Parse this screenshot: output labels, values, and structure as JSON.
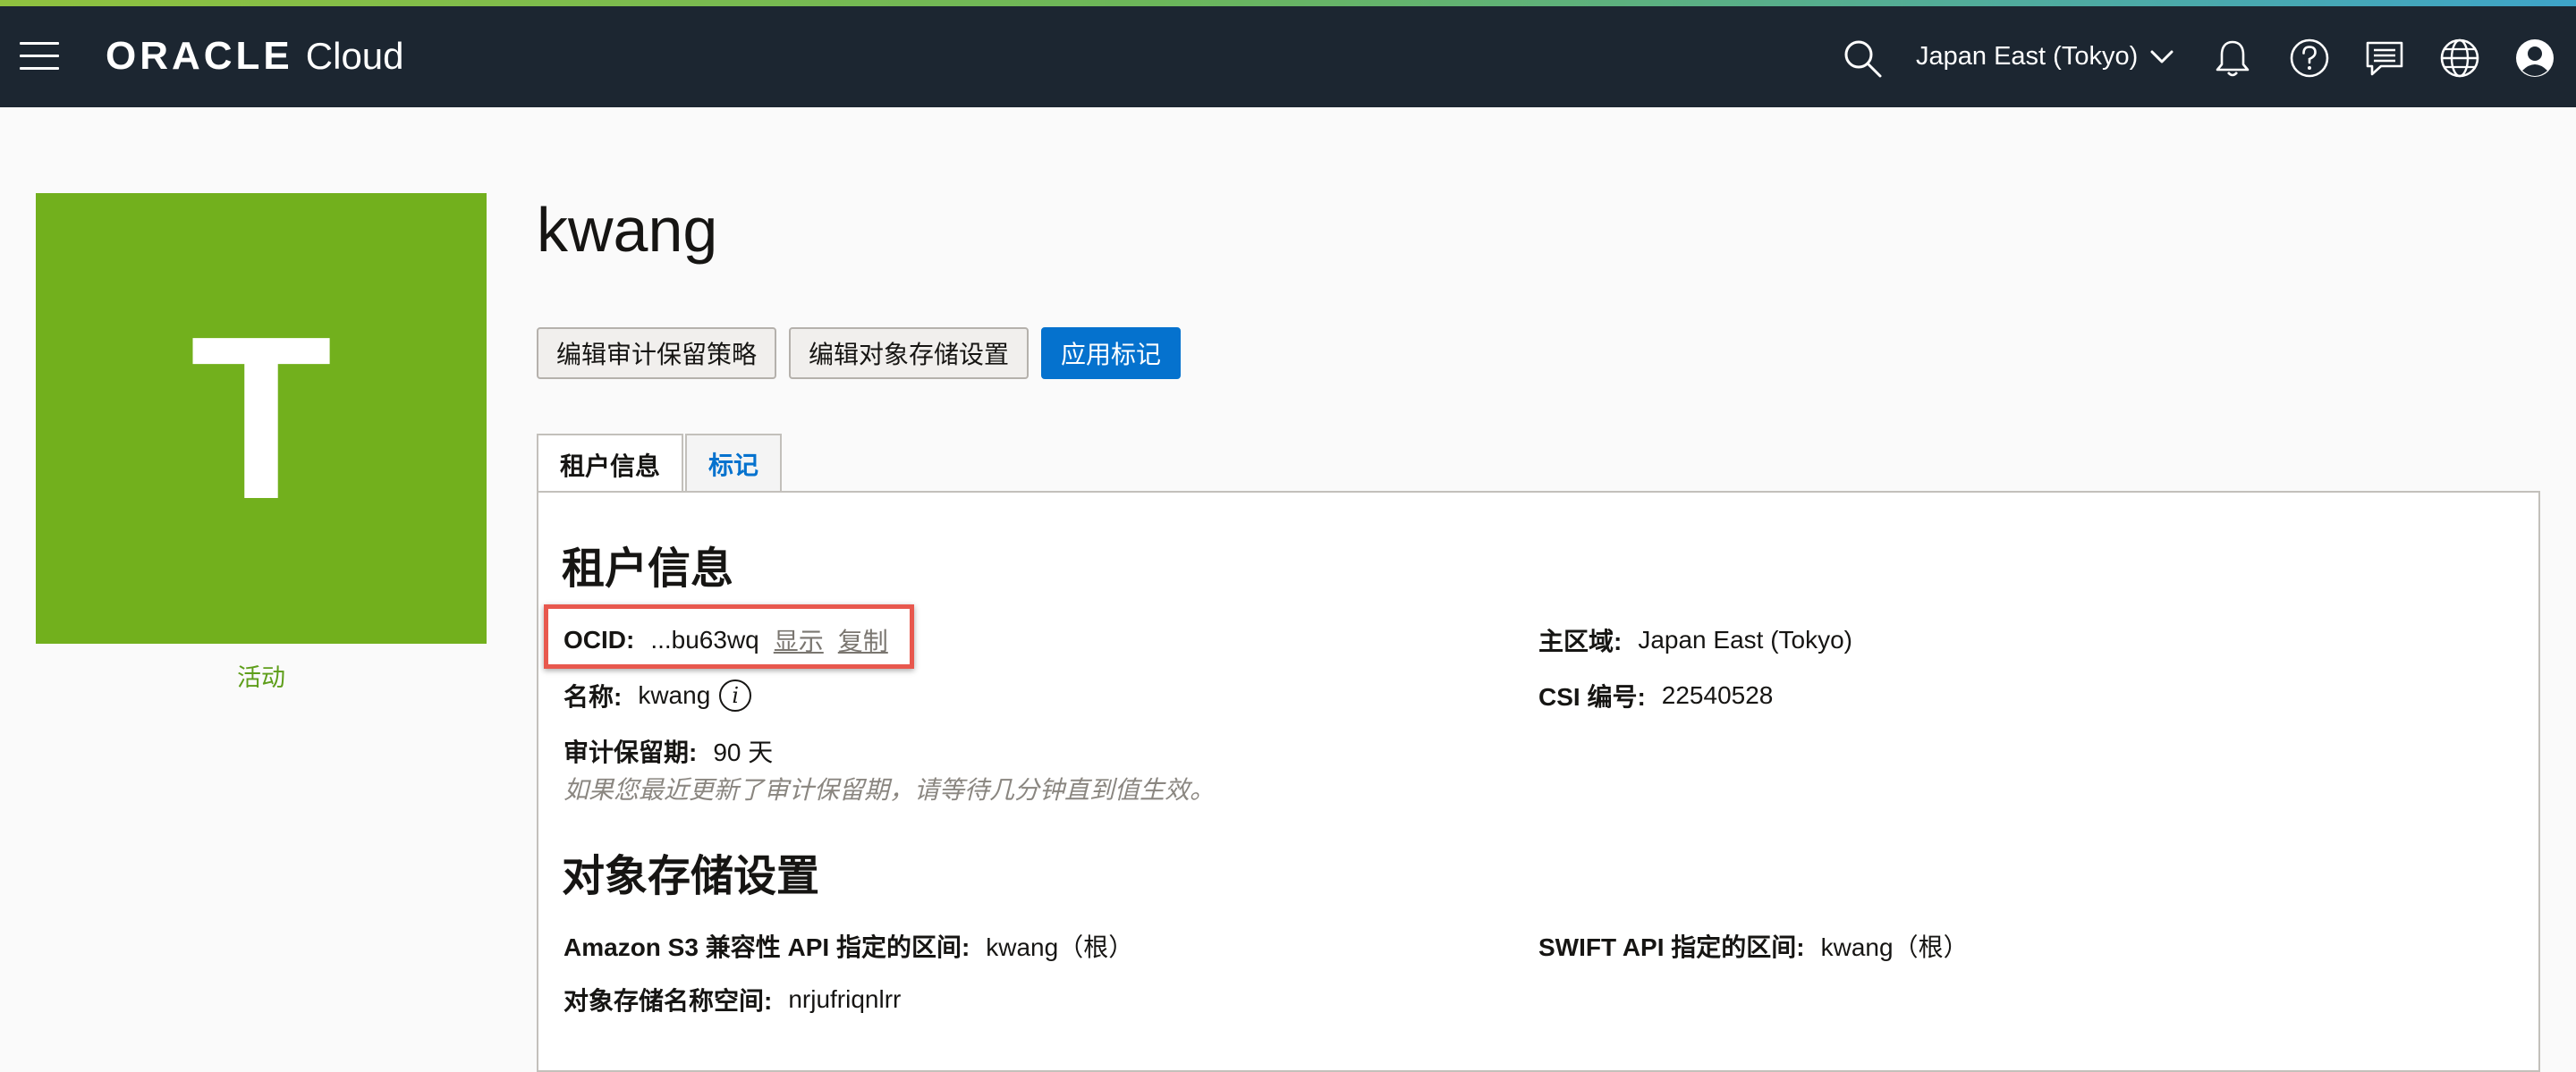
{
  "colors": {
    "topbar_bg": "#1c2631",
    "avatar_bg": "#72b01d",
    "primary": "#0572ce",
    "status_text": "#5e9e1a",
    "highlight": "#e8584e"
  },
  "header": {
    "brand_main": "ORACLE",
    "brand_product": "Cloud",
    "region": "Japan East (Tokyo)",
    "icons": [
      "menu-icon",
      "search-icon",
      "chevron-down-icon",
      "bell-icon",
      "help-icon",
      "chat-icon",
      "globe-icon",
      "user-icon"
    ]
  },
  "tenancy": {
    "avatar_letter": "T",
    "status": "活动",
    "name": "kwang"
  },
  "actions": {
    "edit_audit": "编辑审计保留策略",
    "edit_storage": "编辑对象存储设置",
    "apply_tags": "应用标记"
  },
  "tabs": [
    {
      "label": "租户信息",
      "active": true
    },
    {
      "label": "标记",
      "active": false
    }
  ],
  "tenancy_info": {
    "title": "租户信息",
    "ocid_label": "OCID:",
    "ocid_value": "...bu63wq",
    "ocid_show": "显示",
    "ocid_copy": "复制",
    "name_label": "名称:",
    "name_value": "kwang",
    "audit_label": "审计保留期:",
    "audit_value": "90 天",
    "audit_note": "如果您最近更新了审计保留期，请等待几分钟直到值生效。",
    "home_region_label": "主区域:",
    "home_region_value": "Japan East (Tokyo)",
    "csi_label": "CSI 编号:",
    "csi_value": "22540528"
  },
  "storage": {
    "title": "对象存储设置",
    "s3_label": "Amazon S3 兼容性 API 指定的区间:",
    "s3_value": "kwang（根）",
    "namespace_label": "对象存储名称空间:",
    "namespace_value": "nrjufriqnlrr",
    "swift_label": "SWIFT API 指定的区间:",
    "swift_value": "kwang（根）"
  }
}
